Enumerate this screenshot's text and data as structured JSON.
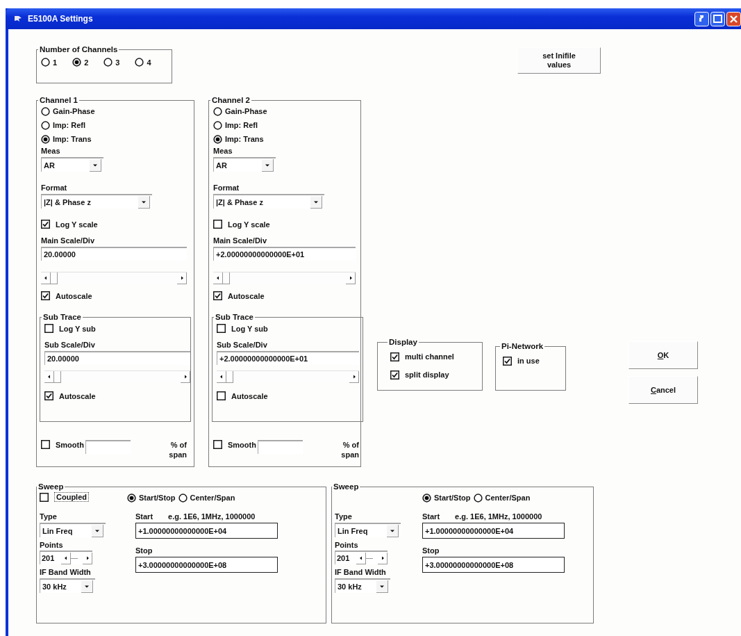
{
  "window": {
    "title": "E5100A Settings"
  },
  "number_of_channels": {
    "title": "Number of Channels",
    "options": [
      {
        "label": "1",
        "selected": false
      },
      {
        "label": "2",
        "selected": true
      },
      {
        "label": "3",
        "selected": false
      },
      {
        "label": "4",
        "selected": false
      }
    ]
  },
  "inifile_button": "set Inifile values",
  "channels": [
    {
      "title": "Channel 1",
      "modes": [
        {
          "label": "Gain-Phase",
          "selected": false
        },
        {
          "label": "Imp: Refl",
          "selected": false
        },
        {
          "label": "Imp: Trans",
          "selected": true
        }
      ],
      "meas": {
        "label": "Meas",
        "value": "AR"
      },
      "format": {
        "label": "Format",
        "value": "|Z| & Phase z"
      },
      "log_y_scale": {
        "label": "Log Y scale",
        "checked": true
      },
      "main_scale": {
        "label": "Main Scale/Div",
        "value": "20.00000"
      },
      "autoscale": {
        "label": "Autoscale",
        "checked": true
      },
      "sub_trace": {
        "title": "Sub Trace",
        "log_y_sub": {
          "label": "Log Y sub",
          "checked": false
        },
        "sub_scale": {
          "label": "Sub Scale/Div",
          "value": "20.00000"
        },
        "autoscale": {
          "label": "Autoscale",
          "checked": true
        }
      },
      "smooth": {
        "label": "Smooth",
        "checked": false,
        "unit": "% of span"
      }
    },
    {
      "title": "Channel 2",
      "modes": [
        {
          "label": "Gain-Phase",
          "selected": false
        },
        {
          "label": "Imp: Refl",
          "selected": false
        },
        {
          "label": "Imp: Trans",
          "selected": true
        }
      ],
      "meas": {
        "label": "Meas",
        "value": "AR"
      },
      "format": {
        "label": "Format",
        "value": "|Z| & Phase z"
      },
      "log_y_scale": {
        "label": "Log Y scale",
        "checked": false
      },
      "main_scale": {
        "label": "Main Scale/Div",
        "value": "+2.00000000000000E+01"
      },
      "autoscale": {
        "label": "Autoscale",
        "checked": true
      },
      "sub_trace": {
        "title": "Sub Trace",
        "log_y_sub": {
          "label": "Log Y sub",
          "checked": false
        },
        "sub_scale": {
          "label": "Sub Scale/Div",
          "value": "+2.00000000000000E+01"
        },
        "autoscale": {
          "label": "Autoscale",
          "checked": false
        }
      },
      "smooth": {
        "label": "Smooth",
        "checked": false,
        "unit": "% of span"
      }
    }
  ],
  "display": {
    "title": "Display",
    "options": [
      {
        "label": "multi channel",
        "checked": true
      },
      {
        "label": "split display",
        "checked": true
      }
    ]
  },
  "pi_network": {
    "title": "Pi-Network",
    "in_use": {
      "label": "in use",
      "checked": true
    }
  },
  "buttons": [
    "OK",
    "Cancel"
  ],
  "sweeps": [
    {
      "title": "Sweep",
      "coupled": {
        "label": "Coupled",
        "checked": false
      },
      "modes": [
        {
          "label": "Start/Stop",
          "selected": true
        },
        {
          "label": "Center/Span",
          "selected": false
        }
      ],
      "type": {
        "label": "Type",
        "value": "Lin Freq"
      },
      "points": {
        "label": "Points",
        "value": "201"
      },
      "if_bandwidth": {
        "label": "IF Band Width",
        "value": "30 kHz"
      },
      "start": {
        "label": "Start",
        "hint": "e.g. 1E6, 1MHz, 1000000",
        "value": "+1.00000000000000E+04"
      },
      "stop": {
        "label": "Stop",
        "value": "+3.00000000000000E+08"
      }
    },
    {
      "title": "Sweep",
      "modes": [
        {
          "label": "Start/Stop",
          "selected": true
        },
        {
          "label": "Center/Span",
          "selected": false
        }
      ],
      "type": {
        "label": "Type",
        "value": "Lin Freq"
      },
      "points": {
        "label": "Points",
        "value": "201"
      },
      "if_bandwidth": {
        "label": "IF Band Width",
        "value": "30 kHz"
      },
      "start": {
        "label": "Start",
        "hint": "e.g. 1E6, 1MHz, 1000000",
        "value": "+1.00000000000000E+04"
      },
      "stop": {
        "label": "Stop",
        "value": "+3.00000000000000E+08"
      }
    }
  ]
}
